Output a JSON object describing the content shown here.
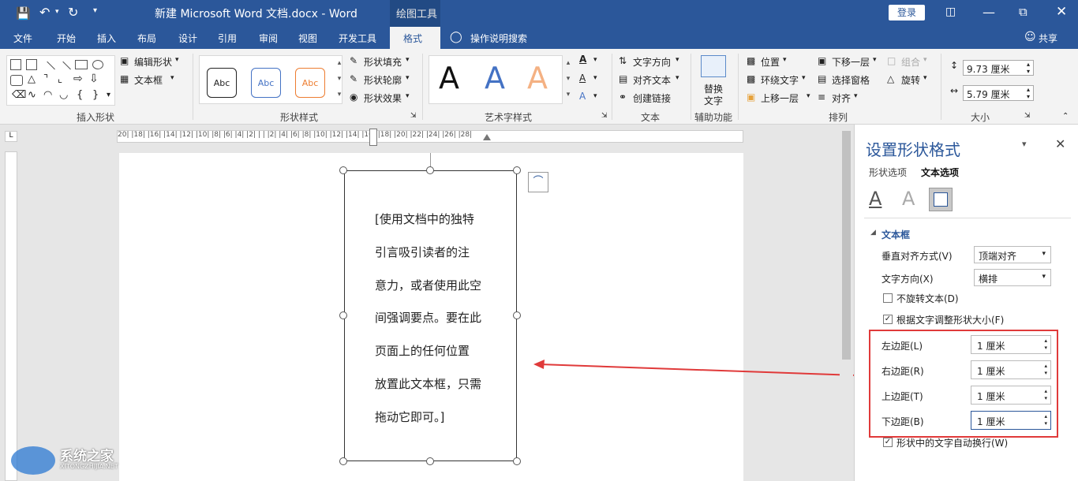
{
  "titlebar": {
    "title": "新建 Microsoft Word 文档.docx  -  Word",
    "context_tab": "绘图工具",
    "login": "登录"
  },
  "tabs": [
    "文件",
    "开始",
    "插入",
    "布局",
    "设计",
    "引用",
    "审阅",
    "视图",
    "开发工具",
    "格式"
  ],
  "tell_me": "操作说明搜索",
  "share": "共享",
  "ribbon": {
    "groups": {
      "insert_shapes": "插入形状",
      "shape_styles": "形状样式",
      "wordart": "艺术字样式",
      "text": "文本",
      "accessibility": "辅助功能",
      "arrange": "排列",
      "size": "大小"
    },
    "edit_shape": "编辑形状",
    "text_box": "文本框",
    "style_sample": "Abc",
    "shape_fill": "形状填充",
    "shape_outline": "形状轮廓",
    "shape_effects": "形状效果",
    "wordart_letter": "A",
    "text_direction": "文字方向",
    "align_text": "对齐文本",
    "create_link": "创建链接",
    "alt_text_1": "替换",
    "alt_text_2": "文字",
    "position": "位置",
    "wrap_text": "环绕文字",
    "bring_forward": "上移一层",
    "send_backward": "下移一层",
    "selection_pane": "选择窗格",
    "align": "对齐",
    "group": "组合",
    "rotate": "旋转",
    "height": "9.73 厘米",
    "width": "5.79 厘米"
  },
  "ruler_text": "20| |18| |16| |14| |12| |10| |8| |6| |4| |2| |  | |2| |4| |6| |8| |10| |12| |14| |16| |18| |20| |22| |24| |26| |28|",
  "textbox_lines": [
    "[使用文档中的独特",
    "引言吸引读者的注",
    "意力，或者使用此空",
    "间强调要点。要在此",
    "页面上的任何位置",
    "放置此文本框，只需",
    "拖动它即可。]"
  ],
  "pane": {
    "title": "设置形状格式",
    "tab_shape": "形状选项",
    "tab_text": "文本选项",
    "section": "文本框",
    "valign_label": "垂直对齐方式(V)",
    "valign_value": "顶端对齐",
    "textdir_label": "文字方向(X)",
    "textdir_value": "横排",
    "no_rotate": "不旋转文本(D)",
    "autofit": "根据文字调整形状大小(F)",
    "left_margin_label": "左边距(L)",
    "right_margin_label": "右边距(R)",
    "top_margin_label": "上边距(T)",
    "bottom_margin_label": "下边距(B)",
    "margin_value": "1 厘米",
    "wrap_in_shape": "形状中的文字自动换行(W)"
  },
  "watermark": {
    "name": "系统之家",
    "url": "XITONGZHIJIA.NET"
  },
  "colors": {
    "brand": "#2b579a",
    "highlight": "#e03a3a"
  }
}
